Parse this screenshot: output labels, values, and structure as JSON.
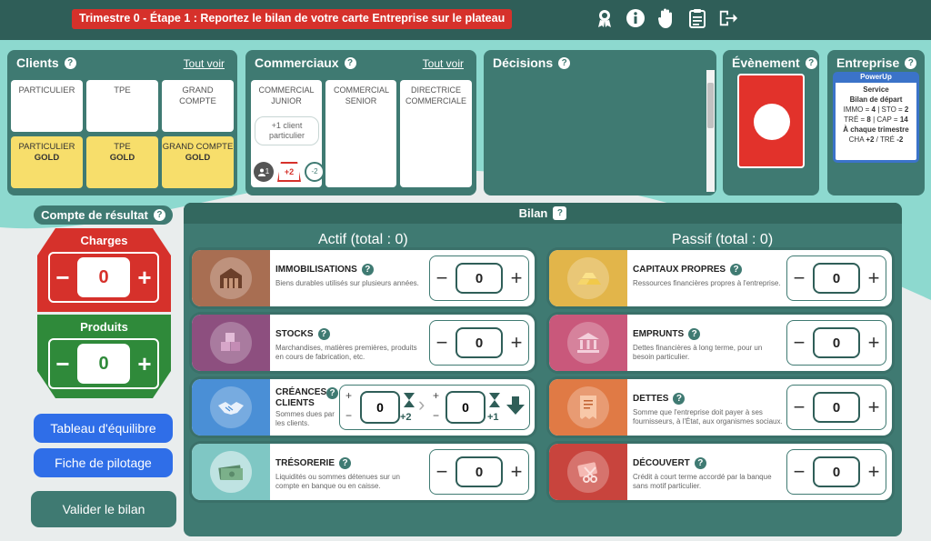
{
  "banner": "Trimestre 0 - Étape 1 : Reportez le bilan de votre carte Entreprise sur le plateau",
  "top_icons": [
    "award-icon",
    "info-icon",
    "hand-icon",
    "clipboard-icon",
    "exit-icon"
  ],
  "clients": {
    "title": "Clients",
    "link": "Tout voir",
    "cards": [
      "PARTICULIER",
      "TPE",
      "GRAND COMPTE"
    ],
    "gold_cards": [
      {
        "label": "PARTICULIER",
        "tier": "GOLD"
      },
      {
        "label": "TPE",
        "tier": "GOLD"
      },
      {
        "label": "GRAND COMPTE",
        "tier": "GOLD"
      }
    ]
  },
  "commerciaux": {
    "title": "Commerciaux",
    "link": "Tout voir",
    "cards": [
      "COMMERCIAL JUNIOR",
      "COMMERCIAL SENIOR",
      "DIRECTRICE COMMERCIALE"
    ],
    "junior_extra": "+1 client particulier",
    "junior_badges": [
      "1",
      "+2",
      "-2"
    ]
  },
  "decisions": {
    "title": "Décisions"
  },
  "evenement": {
    "title": "Évènement"
  },
  "entreprise": {
    "title": "Entreprise",
    "card_title": "PowerUp",
    "line1": "Service",
    "line2": "Bilan de départ",
    "line3_a": "IMMO = ",
    "line3_b": "4",
    "line3_c": " | STO = ",
    "line3_d": "2",
    "line4_a": "TRÉ = ",
    "line4_b": "8",
    "line4_c": " | CAP = ",
    "line4_d": "14",
    "line5": "À chaque trimestre",
    "line6_a": "CHA ",
    "line6_b": "+2",
    "line6_c": " / TRÉ ",
    "line6_d": "-2"
  },
  "compte": {
    "title": "Compte de résultat",
    "charges": {
      "label": "Charges",
      "value": "0"
    },
    "produits": {
      "label": "Produits",
      "value": "0"
    }
  },
  "buttons": {
    "tableau": "Tableau d'équilibre",
    "fiche": "Fiche de pilotage",
    "valider": "Valider le bilan"
  },
  "bilan": {
    "title": "Bilan",
    "actif_title": "Actif (total : 0)",
    "passif_title": "Passif (total : 0)",
    "actif": [
      {
        "name": "IMMOBILISATIONS",
        "desc": "Biens durables utilisés sur plusieurs années.",
        "value": "0"
      },
      {
        "name": "STOCKS",
        "desc": "Marchandises, matières premières, produits en cours de fabrication, etc.",
        "value": "0"
      },
      {
        "name": "CRÉANCES CLIENTS",
        "desc": "Sommes dues par les clients.",
        "value": "0",
        "value2": "0",
        "delay1": "+2",
        "delay2": "+1"
      },
      {
        "name": "TRÉSORERIE",
        "desc": "Liquidités ou sommes détenues sur un compte en banque ou en caisse.",
        "value": "0"
      }
    ],
    "passif": [
      {
        "name": "CAPITAUX PROPRES",
        "desc": "Ressources financières propres à l'entreprise.",
        "value": "0"
      },
      {
        "name": "EMPRUNTS",
        "desc": "Dettes financières à long terme, pour un besoin particulier.",
        "value": "0"
      },
      {
        "name": "DETTES",
        "desc": "Somme que l'entreprise doit payer à ses fournisseurs, à l'État, aux organismes sociaux.",
        "value": "0"
      },
      {
        "name": "DÉCOUVERT",
        "desc": "Crédit à court terme accordé par la banque sans motif particulier.",
        "value": "0"
      }
    ]
  },
  "colors": {
    "teal": "#3f7a72",
    "dark_teal": "#2f5e58",
    "red": "#d6312b",
    "green": "#2f8a3a",
    "blue": "#2f6ee8",
    "gold": "#f7de6b"
  }
}
